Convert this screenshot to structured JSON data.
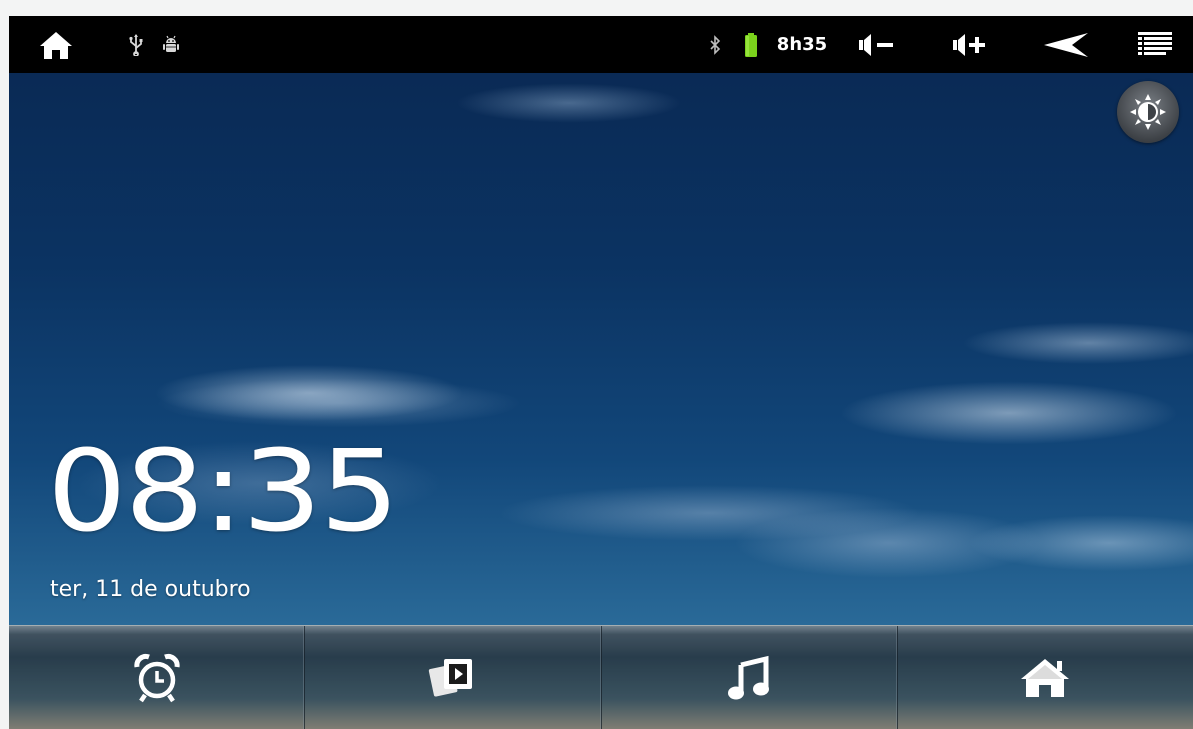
{
  "status_bar": {
    "time": "8h35",
    "icons": {
      "home": "home-icon",
      "usb": "usb-icon",
      "debug": "android-debug-icon",
      "bluetooth": "bluetooth-icon",
      "battery": "battery-icon",
      "volume_down": "volume-down-icon",
      "volume_up": "volume-up-icon",
      "back": "back-icon",
      "menu": "menu-icon"
    },
    "battery_color": "#7bd21c"
  },
  "lock_screen": {
    "clock": "08:35",
    "date": "ter, 11 de outubro"
  },
  "dock": {
    "items": [
      {
        "icon": "alarm-clock-icon"
      },
      {
        "icon": "gallery-icon"
      },
      {
        "icon": "music-icon"
      },
      {
        "icon": "home-icon"
      }
    ]
  },
  "colors": {
    "status_bar_bg": "#000000",
    "sky": "#0b3362",
    "text": "#ffffff"
  }
}
